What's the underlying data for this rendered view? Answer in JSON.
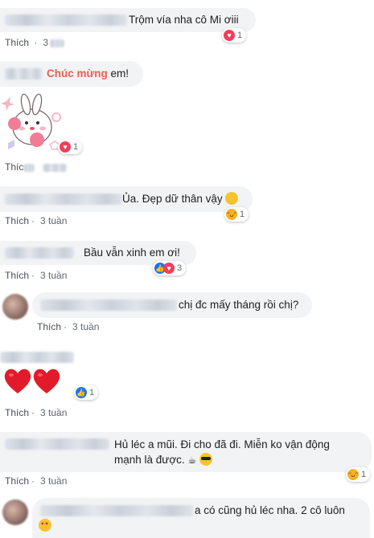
{
  "like_label": "Thích",
  "comments": [
    {
      "text": "Trộm vía nha cô Mi ơiii",
      "time": "3",
      "reaction_count": "1"
    },
    {
      "text_pre": "",
      "highlight": "Chúc mừng",
      "text_post": " em!"
    },
    {
      "like_prefix": "Thíc",
      "reaction_count": "1"
    },
    {
      "text": "Ủa. Đẹp dữ thân vậy",
      "time": "3 tuần",
      "reaction_count": "1"
    },
    {
      "text": "Bầu vẫn xinh em ơi!",
      "time": "3 tuần",
      "reaction_count": "3"
    },
    {
      "text": "chị đc mấy tháng rồi chị?",
      "time": "3 tuần"
    },
    {
      "time": "3 tuần",
      "reaction_count": "1"
    },
    {
      "text": "Hủ léc a mũi. Đi cho đã đi. Miễn ko vận động mạnh là được.",
      "time": "3 tuần",
      "reaction_count": "1"
    },
    {
      "text": "a có cũng hủ léc nha. 2 cô luôn"
    }
  ],
  "icons": {
    "love": "love-reaction-icon",
    "like": "like-reaction-icon",
    "haha": "haha-reaction-icon"
  },
  "colors": {
    "bubble": "#f2f3f5",
    "love": "#f33e58",
    "like": "#1877f2",
    "haha": "#f7b125",
    "highlight": "#e3624d"
  }
}
